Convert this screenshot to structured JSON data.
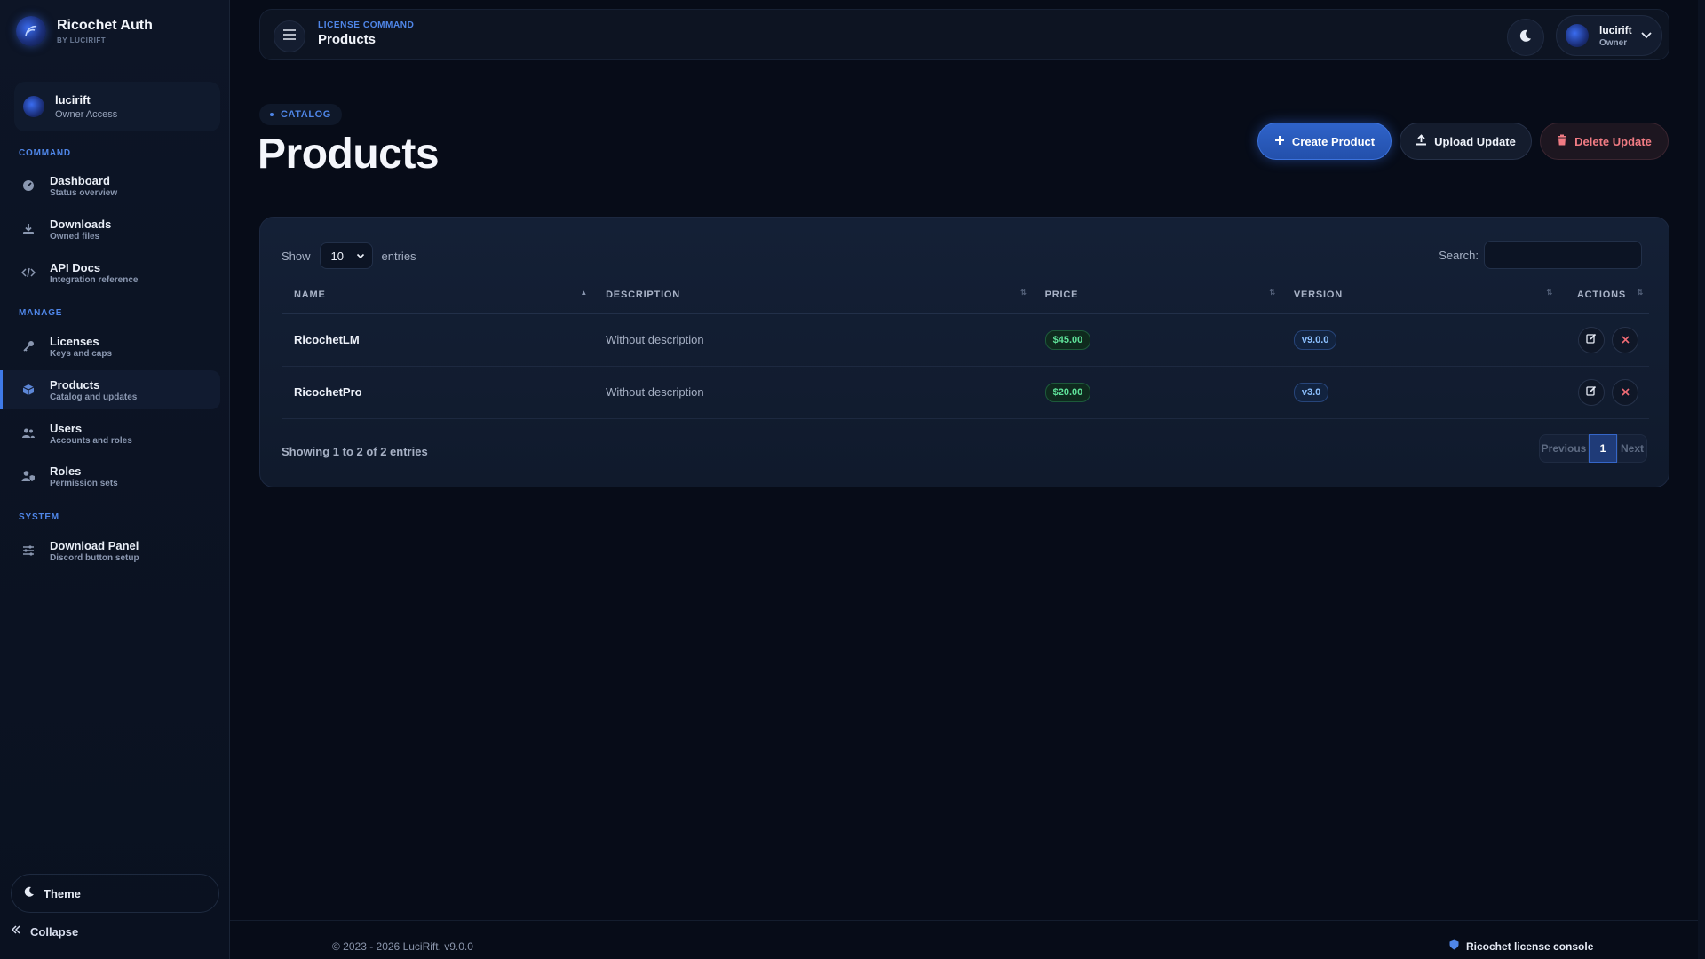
{
  "brand": {
    "title": "Ricochet Auth",
    "subtitle": "BY LUCIRIFT"
  },
  "user_card": {
    "name": "lucirift",
    "role": "Owner Access"
  },
  "sidebar": {
    "sections": {
      "command": "COMMAND",
      "manage": "MANAGE",
      "system": "SYSTEM"
    },
    "items": [
      {
        "title": "Dashboard",
        "sub": "Status overview",
        "icon": "gauge-icon"
      },
      {
        "title": "Downloads",
        "sub": "Owned files",
        "icon": "download-icon"
      },
      {
        "title": "API Docs",
        "sub": "Integration reference",
        "icon": "code-icon"
      },
      {
        "title": "Licenses",
        "sub": "Keys and caps",
        "icon": "key-icon"
      },
      {
        "title": "Products",
        "sub": "Catalog and updates",
        "icon": "box-icon"
      },
      {
        "title": "Users",
        "sub": "Accounts and roles",
        "icon": "users-icon"
      },
      {
        "title": "Roles",
        "sub": "Permission sets",
        "icon": "user-shield-icon"
      },
      {
        "title": "Download Panel",
        "sub": "Discord button setup",
        "icon": "sliders-icon"
      }
    ],
    "theme_label": "Theme",
    "collapse_label": "Collapse"
  },
  "topbar": {
    "breadcrumb_top": "LICENSE COMMAND",
    "breadcrumb_title": "Products",
    "account_name": "lucirift",
    "account_role": "Owner"
  },
  "page": {
    "pill": "CATALOG",
    "title": "Products",
    "buttons": {
      "create": "Create Product",
      "upload": "Upload Update",
      "delete": "Delete Update"
    }
  },
  "table": {
    "show_label": "Show",
    "entries_value": "10",
    "entries_label": "entries",
    "search_label": "Search:",
    "columns": [
      "NAME",
      "DESCRIPTION",
      "PRICE",
      "VERSION",
      "ACTIONS"
    ],
    "rows": [
      {
        "name": "RicochetLM",
        "description": "Without description",
        "price": "$45.00",
        "version": "v9.0.0"
      },
      {
        "name": "RicochetPro",
        "description": "Without description",
        "price": "$20.00",
        "version": "v3.0"
      }
    ],
    "info": "Showing 1 to 2 of 2 entries",
    "pager": {
      "previous": "Previous",
      "current": "1",
      "next": "Next"
    }
  },
  "footer": {
    "left": "© 2023 - 2026 LuciRift. v9.0.0",
    "right": "Ricochet license console"
  },
  "colors": {
    "accent": "#3f7ae8",
    "danger": "#f07b83",
    "success": "#5fe39a",
    "background": "#070c18"
  }
}
